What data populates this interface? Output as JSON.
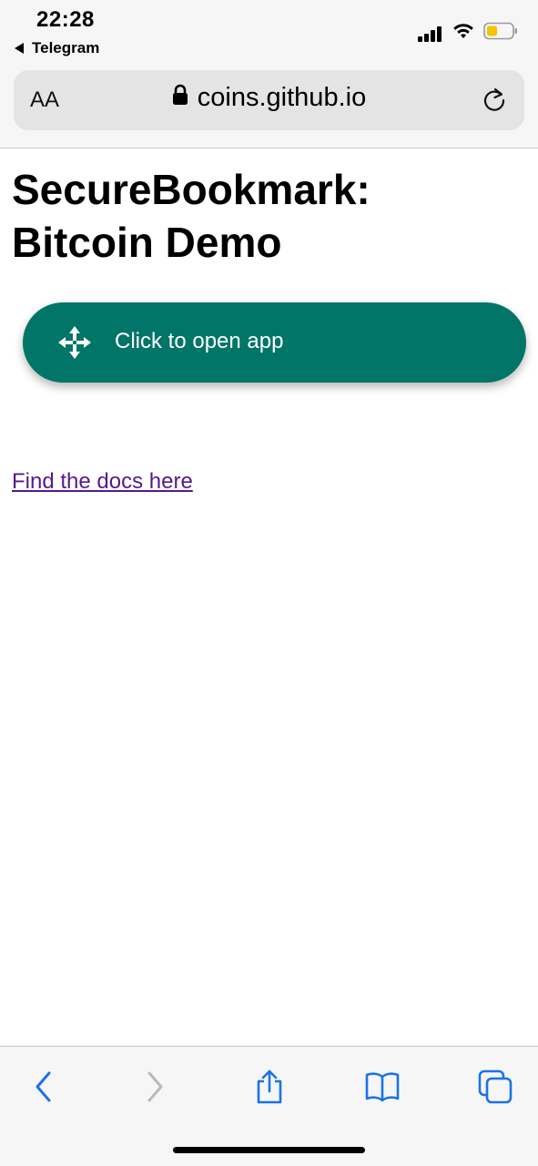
{
  "status_bar": {
    "time": "22:28",
    "back_app": "Telegram"
  },
  "address_bar": {
    "text_size_label": "AA",
    "url": "coins.github.io"
  },
  "page": {
    "title": "SecureBookmark: Bitcoin Demo",
    "open_app_button": "Click to open app",
    "docs_link": "Find the docs here"
  },
  "colors": {
    "button_bg": "#017567",
    "link_visited": "#551a8b",
    "toolbar_blue": "#1a73e8"
  },
  "icons": {
    "back": "chevron-left-icon",
    "forward": "chevron-right-icon",
    "share": "share-icon",
    "bookmarks": "book-icon",
    "tabs": "tabs-icon",
    "move": "move-arrows-icon",
    "lock": "lock-icon",
    "reload": "reload-icon"
  }
}
